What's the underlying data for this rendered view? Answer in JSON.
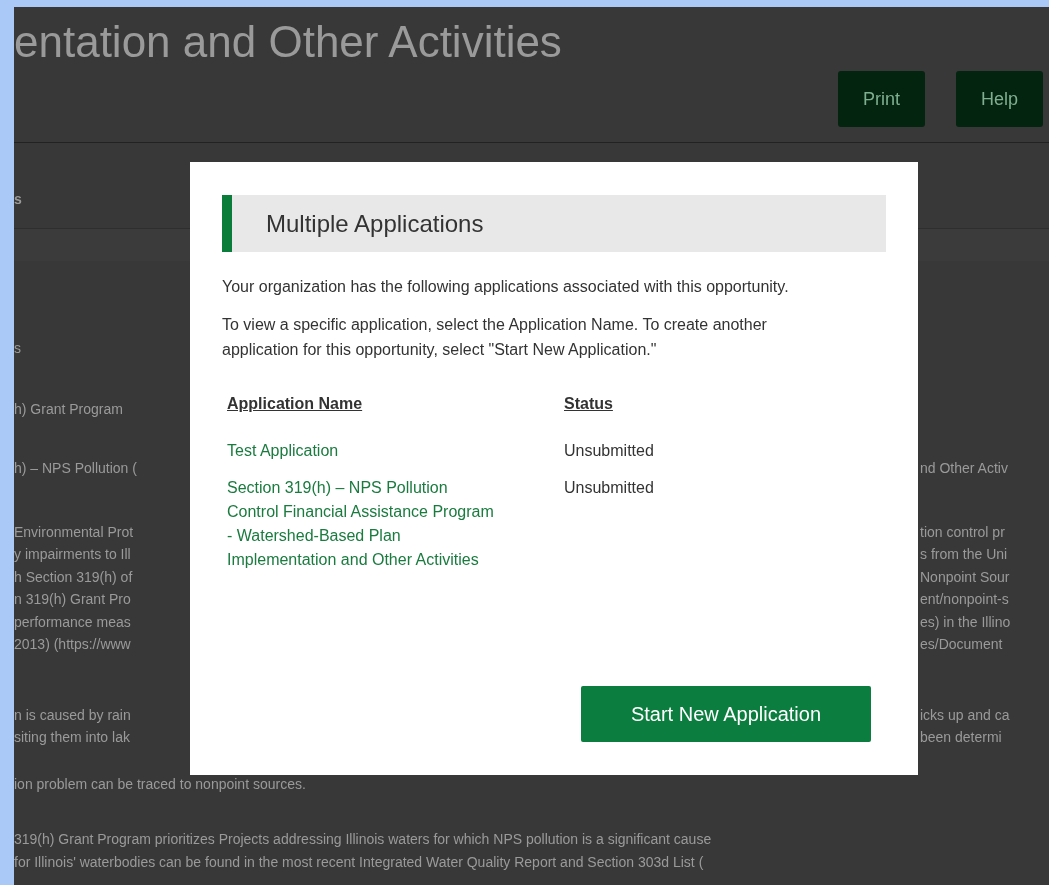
{
  "page": {
    "title": "entation and Other Activities",
    "buttons": [
      "Print",
      "Help"
    ],
    "tab": "s",
    "paragraphs": [
      {
        "lines": [
          {
            "left": "s"
          }
        ]
      },
      {
        "lines": [
          {
            "left": "h) Grant Program"
          }
        ]
      },
      {
        "lines": [
          {
            "left": "h) – NPS Pollution (",
            "right": "nd Other Activ"
          }
        ]
      },
      {
        "lines": [
          {
            "left": "Environmental Prot",
            "right": "tion control pr"
          },
          {
            "left": "y impairments to Ill",
            "right": "s from the Uni"
          },
          {
            "left": "h Section 319(h) of",
            "right": "Nonpoint Sour"
          },
          {
            "left": "n 319(h) Grant Pro",
            "right": "ent/nonpoint-s"
          },
          {
            "left": "performance meas",
            "right": "es) in the Illino"
          },
          {
            "left": "2013) (https://www",
            "right": "es/Document"
          }
        ]
      },
      {
        "lines": [
          {
            "left": "n is caused by rain",
            "right": "icks up and ca"
          },
          {
            "left": "siting them into lak",
            "right": "been determi"
          }
        ]
      },
      {
        "lines": [
          {
            "left": "ion problem can be traced to nonpoint sources."
          }
        ]
      },
      {
        "lines": [
          {
            "left": "319(h) Grant Program prioritizes Projects addressing Illinois waters for which NPS pollution is a significant cause"
          },
          {
            "left": "for Illinois' waterbodies can be found in the most recent Integrated Water Quality Report and Section 303d List ("
          }
        ]
      }
    ]
  },
  "dialog": {
    "title": "Multiple Applications",
    "paragraphs": [
      "Your organization has the following applications associated with this opportunity.",
      "To view a specific application, select the Application Name. To create another application for this opportunity, select \"Start New Application.\""
    ],
    "columns": [
      "Application Name",
      "Status"
    ],
    "rows": [
      {
        "name": "Test Application",
        "status": "Unsubmitted"
      },
      {
        "name": "Section 319(h) – NPS Pollution Control Financial Assistance Program - Watershed-Based Plan Implementation and Other Activities",
        "status": "Unsubmitted"
      }
    ],
    "button": "Start New Application"
  }
}
